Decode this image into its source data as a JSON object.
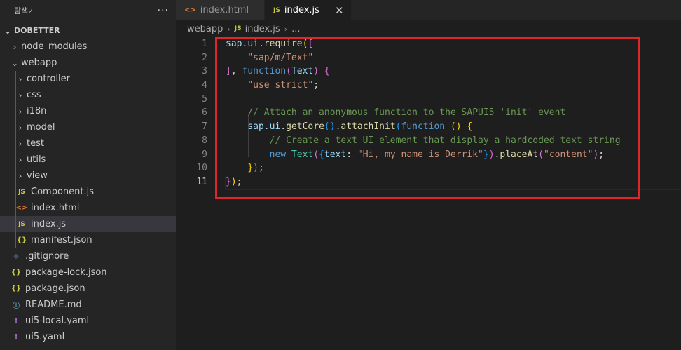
{
  "sidebar": {
    "title": "탐색기",
    "more_label": "···",
    "root": "DOBETTER",
    "items": [
      {
        "label": "node_modules",
        "kind": "folder",
        "level": 1,
        "open": false
      },
      {
        "label": "webapp",
        "kind": "folder",
        "level": 1,
        "open": true
      },
      {
        "label": "controller",
        "kind": "folder",
        "level": 2,
        "open": false
      },
      {
        "label": "css",
        "kind": "folder",
        "level": 2,
        "open": false
      },
      {
        "label": "i18n",
        "kind": "folder",
        "level": 2,
        "open": false
      },
      {
        "label": "model",
        "kind": "folder",
        "level": 2,
        "open": false
      },
      {
        "label": "test",
        "kind": "folder",
        "level": 2,
        "open": false
      },
      {
        "label": "utils",
        "kind": "folder",
        "level": 2,
        "open": false
      },
      {
        "label": "view",
        "kind": "folder",
        "level": 2,
        "open": false
      },
      {
        "label": "Component.js",
        "kind": "js",
        "level": 2
      },
      {
        "label": "index.html",
        "kind": "html",
        "level": 2
      },
      {
        "label": "index.js",
        "kind": "js",
        "level": 2,
        "active": true
      },
      {
        "label": "manifest.json",
        "kind": "json",
        "level": 2
      },
      {
        "label": ".gitignore",
        "kind": "git",
        "level": 1
      },
      {
        "label": "package-lock.json",
        "kind": "json",
        "level": 1
      },
      {
        "label": "package.json",
        "kind": "json",
        "level": 1
      },
      {
        "label": "README.md",
        "kind": "info",
        "level": 1
      },
      {
        "label": "ui5-local.yaml",
        "kind": "yaml",
        "level": 1
      },
      {
        "label": "ui5.yaml",
        "kind": "yaml",
        "level": 1
      }
    ],
    "icons": {
      "js": "JS",
      "html": "<>",
      "json": "{}",
      "info": "ⓘ",
      "yaml": "!",
      "git": "◆"
    }
  },
  "tabs": [
    {
      "label": "index.html",
      "icon": "<>",
      "active": false
    },
    {
      "label": "index.js",
      "icon": "JS",
      "active": true,
      "close": "✕"
    }
  ],
  "breadcrumb": {
    "folder": "webapp",
    "file_icon": "JS",
    "file": "index.js",
    "more": "..."
  },
  "editor": {
    "current_line": 11,
    "line_numbers": [
      "1",
      "2",
      "3",
      "4",
      "5",
      "6",
      "7",
      "8",
      "9",
      "10",
      "11"
    ],
    "lines": [
      [
        {
          "t": "sap",
          "c": "#9cdcfe"
        },
        {
          "t": ".",
          "c": "#d4d4d4"
        },
        {
          "t": "ui",
          "c": "#9cdcfe"
        },
        {
          "t": ".",
          "c": "#d4d4d4"
        },
        {
          "t": "require",
          "c": "#dcdcaa"
        },
        {
          "t": "(",
          "c": "#ffd700"
        },
        {
          "t": "[",
          "c": "#da70d6"
        }
      ],
      [
        {
          "t": "    ",
          "c": "#d4d4d4"
        },
        {
          "t": "\"sap/m/Text\"",
          "c": "#ce9178"
        }
      ],
      [
        {
          "t": "]",
          "c": "#da70d6"
        },
        {
          "t": ", ",
          "c": "#d4d4d4"
        },
        {
          "t": "function",
          "c": "#569cd6"
        },
        {
          "t": "(",
          "c": "#da70d6"
        },
        {
          "t": "Text",
          "c": "#9cdcfe"
        },
        {
          "t": ")",
          "c": "#da70d6"
        },
        {
          "t": " ",
          "c": "#d4d4d4"
        },
        {
          "t": "{",
          "c": "#da70d6"
        }
      ],
      [
        {
          "t": "    ",
          "c": "#d4d4d4"
        },
        {
          "t": "\"use strict\"",
          "c": "#ce9178"
        },
        {
          "t": ";",
          "c": "#d4d4d4"
        }
      ],
      [
        {
          "t": "",
          "c": "#d4d4d4"
        }
      ],
      [
        {
          "t": "    ",
          "c": "#d4d4d4"
        },
        {
          "t": "// Attach an anonymous function to the SAPUI5 'init' event",
          "c": "#6a9955"
        }
      ],
      [
        {
          "t": "    ",
          "c": "#d4d4d4"
        },
        {
          "t": "sap",
          "c": "#9cdcfe"
        },
        {
          "t": ".",
          "c": "#d4d4d4"
        },
        {
          "t": "ui",
          "c": "#9cdcfe"
        },
        {
          "t": ".",
          "c": "#d4d4d4"
        },
        {
          "t": "getCore",
          "c": "#dcdcaa"
        },
        {
          "t": "()",
          "c": "#179fff"
        },
        {
          "t": ".",
          "c": "#d4d4d4"
        },
        {
          "t": "attachInit",
          "c": "#dcdcaa"
        },
        {
          "t": "(",
          "c": "#179fff"
        },
        {
          "t": "function",
          "c": "#569cd6"
        },
        {
          "t": " ",
          "c": "#d4d4d4"
        },
        {
          "t": "()",
          "c": "#ffd700"
        },
        {
          "t": " ",
          "c": "#d4d4d4"
        },
        {
          "t": "{",
          "c": "#ffd700"
        }
      ],
      [
        {
          "t": "        ",
          "c": "#d4d4d4"
        },
        {
          "t": "// Create a text UI element that display a hardcoded text string",
          "c": "#6a9955"
        }
      ],
      [
        {
          "t": "        ",
          "c": "#d4d4d4"
        },
        {
          "t": "new",
          "c": "#569cd6"
        },
        {
          "t": " ",
          "c": "#d4d4d4"
        },
        {
          "t": "Text",
          "c": "#4ec9b0"
        },
        {
          "t": "(",
          "c": "#da70d6"
        },
        {
          "t": "{",
          "c": "#179fff"
        },
        {
          "t": "text",
          "c": "#9cdcfe"
        },
        {
          "t": ": ",
          "c": "#d4d4d4"
        },
        {
          "t": "\"Hi, my name is Derrik\"",
          "c": "#ce9178"
        },
        {
          "t": "}",
          "c": "#179fff"
        },
        {
          "t": ")",
          "c": "#da70d6"
        },
        {
          "t": ".",
          "c": "#d4d4d4"
        },
        {
          "t": "placeAt",
          "c": "#dcdcaa"
        },
        {
          "t": "(",
          "c": "#da70d6"
        },
        {
          "t": "\"content\"",
          "c": "#ce9178"
        },
        {
          "t": ")",
          "c": "#da70d6"
        },
        {
          "t": ";",
          "c": "#d4d4d4"
        }
      ],
      [
        {
          "t": "    ",
          "c": "#d4d4d4"
        },
        {
          "t": "}",
          "c": "#ffd700"
        },
        {
          "t": ")",
          "c": "#179fff"
        },
        {
          "t": ";",
          "c": "#d4d4d4"
        }
      ],
      [
        {
          "t": "}",
          "c": "#da70d6"
        },
        {
          "t": ")",
          "c": "#ffd700"
        },
        {
          "t": ";",
          "c": "#d4d4d4"
        }
      ]
    ]
  },
  "highlight_color": "#e0262b"
}
